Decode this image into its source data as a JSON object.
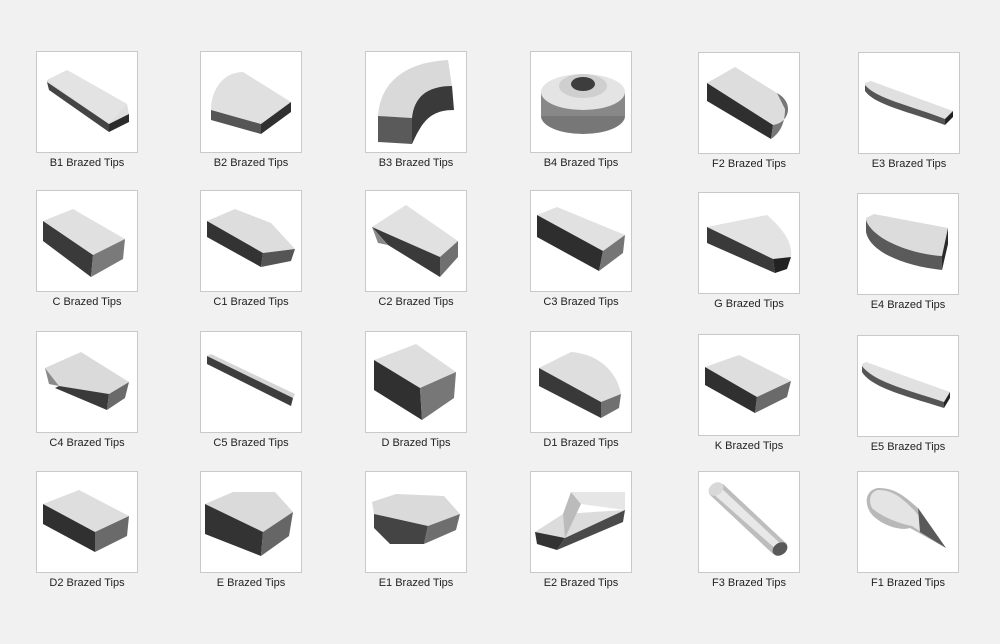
{
  "items": [
    {
      "label": "B1 Brazed Tips",
      "icon": "b1-tip-icon"
    },
    {
      "label": "B2 Brazed Tips",
      "icon": "b2-tip-icon"
    },
    {
      "label": "B3 Brazed Tips",
      "icon": "b3-tip-icon"
    },
    {
      "label": "B4 Brazed Tips",
      "icon": "b4-tip-icon"
    },
    {
      "label": "F2 Brazed Tips",
      "icon": "f2-tip-icon"
    },
    {
      "label": "E3 Brazed Tips",
      "icon": "e3-tip-icon"
    },
    {
      "label": "C Brazed Tips",
      "icon": "c-tip-icon"
    },
    {
      "label": "C1 Brazed Tips",
      "icon": "c1-tip-icon"
    },
    {
      "label": "C2 Brazed Tips",
      "icon": "c2-tip-icon"
    },
    {
      "label": "C3 Brazed Tips",
      "icon": "c3-tip-icon"
    },
    {
      "label": "G Brazed Tips",
      "icon": "g-tip-icon"
    },
    {
      "label": "E4 Brazed Tips",
      "icon": "e4-tip-icon"
    },
    {
      "label": "C4 Brazed Tips",
      "icon": "c4-tip-icon"
    },
    {
      "label": "C5 Brazed Tips",
      "icon": "c5-tip-icon"
    },
    {
      "label": "D Brazed Tips",
      "icon": "d-tip-icon"
    },
    {
      "label": "D1 Brazed Tips",
      "icon": "d1-tip-icon"
    },
    {
      "label": "K Brazed Tips",
      "icon": "k-tip-icon"
    },
    {
      "label": "E5 Brazed Tips",
      "icon": "e5-tip-icon"
    },
    {
      "label": "D2 Brazed Tips",
      "icon": "d2-tip-icon"
    },
    {
      "label": "E Brazed Tips",
      "icon": "e-tip-icon"
    },
    {
      "label": "E1 Brazed Tips",
      "icon": "e1-tip-icon"
    },
    {
      "label": "E2 Brazed Tips",
      "icon": "e2-tip-icon"
    },
    {
      "label": "F3 Brazed Tips",
      "icon": "f3-tip-icon"
    },
    {
      "label": "F1 Brazed Tips",
      "icon": "f1-tip-icon"
    }
  ]
}
